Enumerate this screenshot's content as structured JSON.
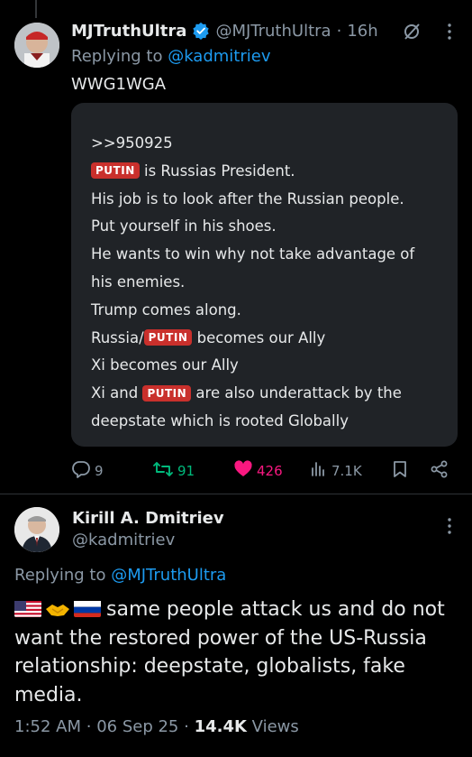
{
  "tweet1": {
    "display_name": "MJTruthUltra",
    "handle": "@MJTruthUltra",
    "separator": "·",
    "time": "16h",
    "replying_prefix": "Replying to ",
    "replying_to": "@kadmitriev",
    "text": "WWG1WGA",
    "card_lines": [
      ">>950925",
      "is Russias President.",
      "His job is to look after the Russian people.",
      "Put yourself in his shoes.",
      "He wants to win why not take advantage of",
      "his enemies.",
      "Trump comes along.",
      "Russia/",
      "becomes our Ally",
      "Xi becomes our Ally",
      "Xi and",
      "are also underattack by the",
      "deepstate which is rooted Globally"
    ],
    "tag_label": "PUTIN",
    "stats": {
      "replies": "9",
      "reposts": "91",
      "likes": "426",
      "views": "7.1K"
    },
    "icons": {
      "verified": "verified-badge-icon",
      "grok": "grok-icon",
      "more": "more-icon",
      "reply": "reply-icon",
      "repost": "repost-icon",
      "like": "heart-icon",
      "views": "views-icon",
      "bookmark": "bookmark-icon",
      "share": "share-icon"
    },
    "colors": {
      "tag_bg": "#c9302c",
      "repost": "#00ba7c",
      "like": "#f91880",
      "link": "#1d9bf0"
    }
  },
  "tweet2": {
    "display_name": "Kirill A. Dmitriev",
    "handle": "@kadmitriev",
    "replying_prefix": "Replying to ",
    "replying_to": "@MJTruthUltra",
    "flags": [
      "us-flag",
      "handshake-emoji",
      "russia-flag"
    ],
    "text": "same people attack us and do not want the restored power of the US-Russia relationship: deepstate, globalists, fake media.",
    "time": "1:52 AM",
    "sep1": "·",
    "date": "06 Sep 25",
    "sep2": "·",
    "views_count": "14.4K",
    "views_label": " Views"
  }
}
